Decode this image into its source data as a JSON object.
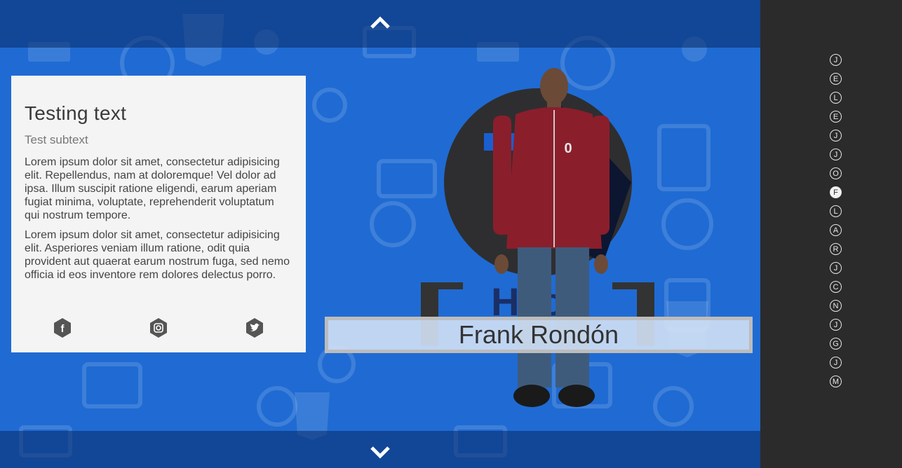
{
  "card": {
    "title": "Testing text",
    "subtitle": "Test subtext",
    "paragraph1": "Lorem ipsum dolor sit amet, consectetur adipisicing elit. Repellendus, nam at doloremque! Vel dolor ad ipsa. Illum suscipit ratione eligendi, earum aperiam fugiat minima, voluptate, reprehenderit voluptatum qui nostrum tempore.",
    "paragraph2": "Lorem ipsum dolor sit amet, consectetur adipisicing elit. Asperiores veniam illum ratione, odit quia provident aut quaerat earum nostrum fuga, sed nemo officia id eos inventore rem dolores delectus porro.",
    "social": [
      {
        "icon": "facebook-icon",
        "glyph": "f"
      },
      {
        "icon": "instagram-icon",
        "glyph": ""
      },
      {
        "icon": "twitter-icon",
        "glyph": ""
      }
    ]
  },
  "profile": {
    "name": "Frank Rondón"
  },
  "sidebar": {
    "letters": [
      "J",
      "E",
      "L",
      "E",
      "J",
      "J",
      "O",
      "F",
      "L",
      "A",
      "R",
      "J",
      "C",
      "N",
      "J",
      "G",
      "J",
      "M"
    ],
    "active_index": 7
  },
  "colors": {
    "background": "#1f6bd3",
    "sidebar": "#2b2b2b",
    "card": "#f4f4f4",
    "accent": "#8b1e2b"
  }
}
